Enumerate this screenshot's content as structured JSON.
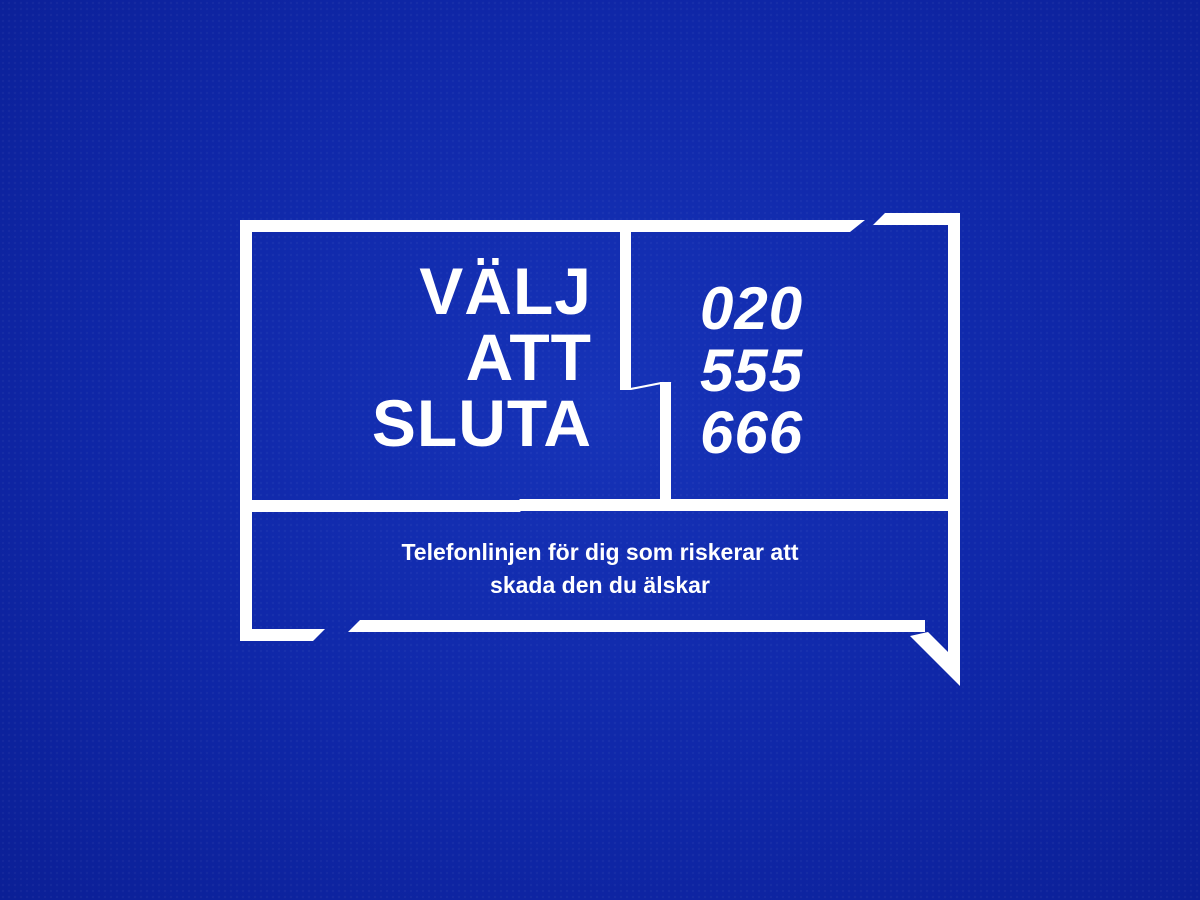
{
  "logo": {
    "headline_lines": [
      "VÄLJ",
      "ATT",
      "SLUTA"
    ],
    "phone_lines": [
      "020",
      "555",
      "666"
    ],
    "tagline_line1": "Telefonlinjen för dig som riskerar att",
    "tagline_line2": "skada den du älskar"
  },
  "colors": {
    "background": "#0f27a8",
    "foreground": "#ffffff"
  }
}
